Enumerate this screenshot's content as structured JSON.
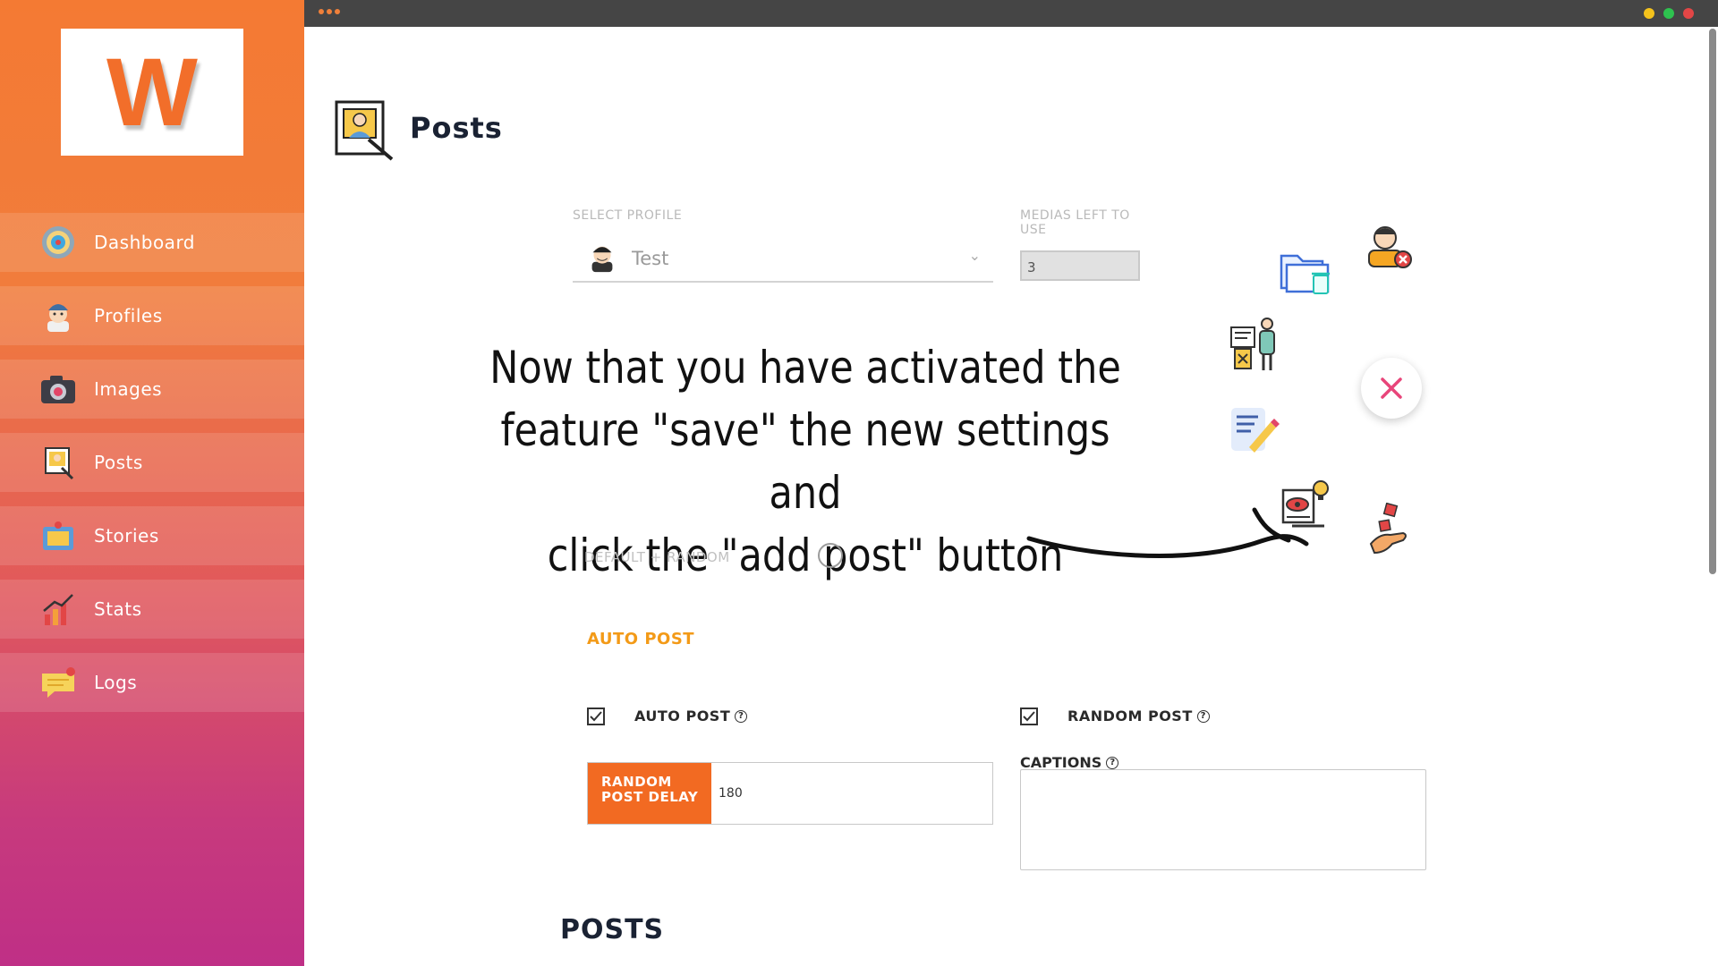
{
  "window": {
    "dot_colors": [
      "#f4c21c",
      "#2ec24f",
      "#e24646"
    ]
  },
  "sidebar": {
    "logo_letter": "W",
    "items": [
      {
        "label": "Dashboard",
        "icon": "dashboard-gauge-icon"
      },
      {
        "label": "Profiles",
        "icon": "profile-avatar-icon"
      },
      {
        "label": "Images",
        "icon": "camera-icon"
      },
      {
        "label": "Posts",
        "icon": "posts-icon"
      },
      {
        "label": "Stories",
        "icon": "stories-icon"
      },
      {
        "label": "Stats",
        "icon": "stats-chart-icon"
      },
      {
        "label": "Logs",
        "icon": "logs-message-icon"
      }
    ]
  },
  "main": {
    "title": "Posts",
    "select_profile": {
      "label": "SELECT PROFILE",
      "value": "Test"
    },
    "medias_left": {
      "label": "MEDIAS LEFT TO USE",
      "value": "3"
    },
    "annotation": {
      "line1": "Now that you have activated the",
      "line2": "feature \"save\" the new settings and",
      "line3": "click the \"add post\" button"
    },
    "default_random_label": "DEFAULT + RANDOM",
    "auto_post_section": "AUTO POST",
    "auto_post": {
      "label": "AUTO POST",
      "checked": true
    },
    "random_post": {
      "label": "RANDOM POST",
      "checked": true
    },
    "random_post_delay": {
      "label_line1": "RANDOM",
      "label_line2": "POST DELAY",
      "value": "180"
    },
    "captions": {
      "label": "CAPTIONS",
      "value": ""
    },
    "posts_heading": "POSTS"
  },
  "fab_menu": {
    "close_icon": "close-icon",
    "items": [
      "folder-delete-icon",
      "user-remove-icon",
      "presenter-icon",
      "edit-document-icon",
      "preview-idea-icon",
      "hand-dice-icon"
    ]
  },
  "colors": {
    "accent": "#f26a22",
    "section_head": "#f39a17",
    "close": "#e8457a"
  }
}
